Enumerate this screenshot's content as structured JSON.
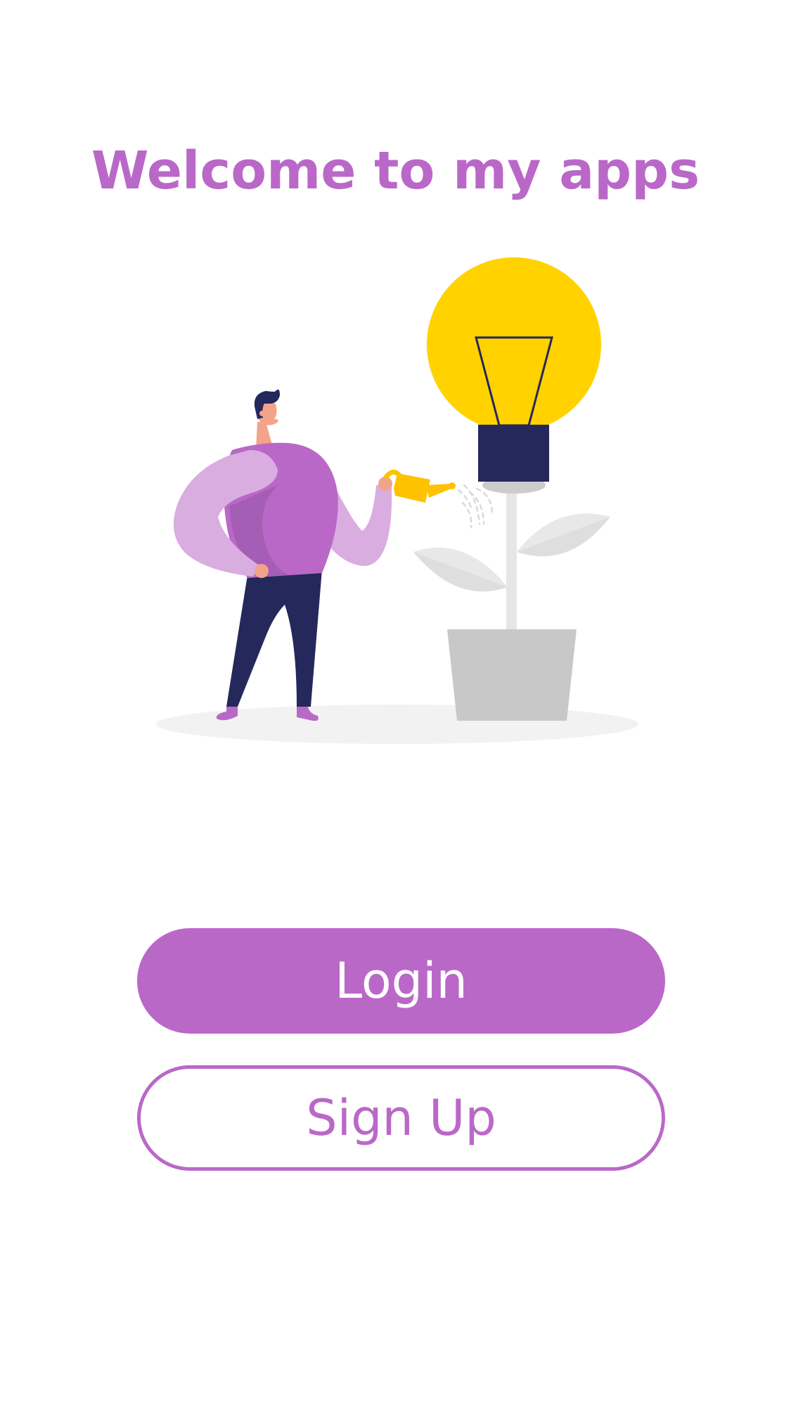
{
  "welcome": {
    "title": "Welcome to my apps"
  },
  "illustration": {
    "name": "person-watering-lightbulb-plant",
    "colors": {
      "accent": "#BA68C8",
      "accent_light": "#D9ADE0",
      "accent_dark": "#A55EB5",
      "navy": "#24285B",
      "bulb": "#FFD200",
      "skin": "#F3A38A",
      "gray": "#C8C8C8",
      "leaf_light": "#E6E6E6",
      "leaf_dark": "#D9D9D9",
      "shadow": "#F2F2F2"
    }
  },
  "actions": {
    "login_label": "Login",
    "signup_label": "Sign Up"
  },
  "theme": {
    "primary": "#BA68C8",
    "background": "#FFFFFF",
    "button_text": "#FFFFFF"
  }
}
